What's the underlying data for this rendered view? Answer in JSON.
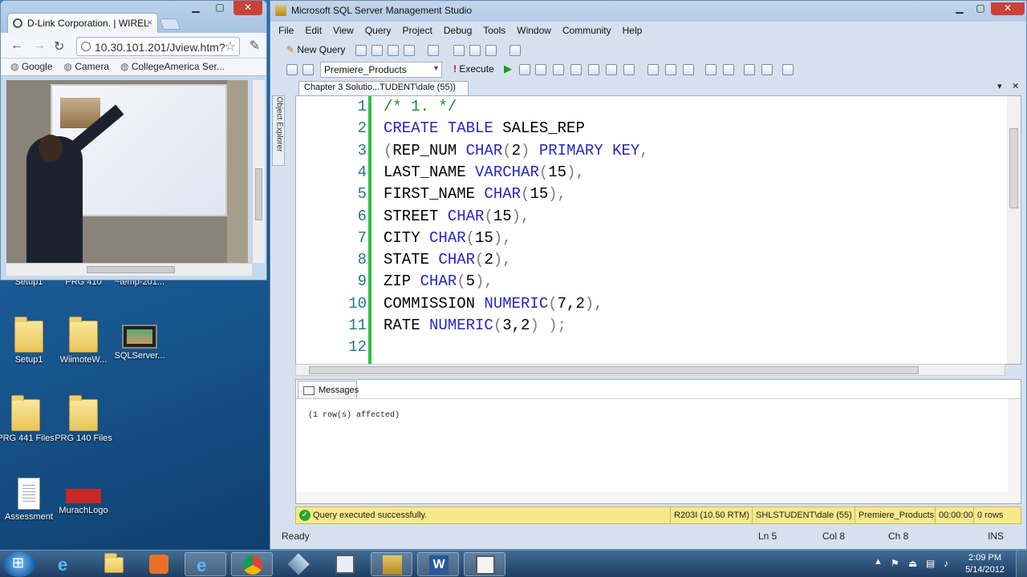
{
  "desktop": {
    "icons": [
      {
        "label": "Setup1"
      },
      {
        "label": "PRG 410"
      },
      {
        "label": "~temp-201..."
      },
      {
        "label": "Setup1"
      },
      {
        "label": "WiimoteW..."
      },
      {
        "label": "SQLServer..."
      },
      {
        "label": "PRG 441 Files"
      },
      {
        "label": "PRG 140 Files"
      },
      {
        "label": "Assessment"
      },
      {
        "label": "MurachLogo"
      }
    ]
  },
  "browser": {
    "tab_title": "D-Link Corporation. | WIREL",
    "tab_close": "×",
    "url": "10.30.101.201/Jview.htm?",
    "bookmarks": [
      "Google",
      "Camera",
      "CollegeAmerica Ser..."
    ]
  },
  "ssms": {
    "title": "Microsoft SQL Server Management Studio",
    "menu": [
      "File",
      "Edit",
      "View",
      "Query",
      "Project",
      "Debug",
      "Tools",
      "Window",
      "Community",
      "Help"
    ],
    "new_query": "New Query",
    "database": "Premiere_Products",
    "execute": "Execute",
    "object_explorer": "Object Explorer",
    "doc_tab": "Chapter 3 Solutio...TUDENT\\dale (55))",
    "code": [
      {
        "n": "1",
        "parts": [
          {
            "t": "/* 1. */",
            "c": "cm"
          }
        ]
      },
      {
        "n": "2",
        "parts": [
          {
            "t": "CREATE TABLE",
            "c": "kw"
          },
          {
            "t": " SALES_REP",
            "c": ""
          }
        ]
      },
      {
        "n": "3",
        "parts": [
          {
            "t": "(",
            "c": "gr"
          },
          {
            "t": "REP_NUM ",
            "c": ""
          },
          {
            "t": "CHAR",
            "c": "kw"
          },
          {
            "t": "(",
            "c": "gr"
          },
          {
            "t": "2",
            "c": ""
          },
          {
            "t": ") ",
            "c": "gr"
          },
          {
            "t": "PRIMARY KEY",
            "c": "kw"
          },
          {
            "t": ",",
            "c": "gr"
          }
        ]
      },
      {
        "n": "4",
        "parts": [
          {
            "t": "LAST_NAME ",
            "c": ""
          },
          {
            "t": "VARCHAR",
            "c": "kw"
          },
          {
            "t": "(",
            "c": "gr"
          },
          {
            "t": "15",
            "c": ""
          },
          {
            "t": "),",
            "c": "gr"
          }
        ]
      },
      {
        "n": "5",
        "parts": [
          {
            "t": "FIRST_NAME ",
            "c": ""
          },
          {
            "t": "CHAR",
            "c": "kw"
          },
          {
            "t": "(",
            "c": "gr"
          },
          {
            "t": "15",
            "c": ""
          },
          {
            "t": "),",
            "c": "gr"
          }
        ]
      },
      {
        "n": "6",
        "parts": [
          {
            "t": "STREET ",
            "c": ""
          },
          {
            "t": "CHAR",
            "c": "kw"
          },
          {
            "t": "(",
            "c": "gr"
          },
          {
            "t": "15",
            "c": ""
          },
          {
            "t": "),",
            "c": "gr"
          }
        ]
      },
      {
        "n": "7",
        "parts": [
          {
            "t": "CITY ",
            "c": ""
          },
          {
            "t": "CHAR",
            "c": "kw"
          },
          {
            "t": "(",
            "c": "gr"
          },
          {
            "t": "15",
            "c": ""
          },
          {
            "t": "),",
            "c": "gr"
          }
        ]
      },
      {
        "n": "8",
        "parts": [
          {
            "t": "STATE ",
            "c": ""
          },
          {
            "t": "CHAR",
            "c": "kw"
          },
          {
            "t": "(",
            "c": "gr"
          },
          {
            "t": "2",
            "c": ""
          },
          {
            "t": "),",
            "c": "gr"
          }
        ]
      },
      {
        "n": "9",
        "parts": [
          {
            "t": "ZIP ",
            "c": ""
          },
          {
            "t": "CHAR",
            "c": "kw"
          },
          {
            "t": "(",
            "c": "gr"
          },
          {
            "t": "5",
            "c": ""
          },
          {
            "t": "),",
            "c": "gr"
          }
        ]
      },
      {
        "n": "10",
        "parts": [
          {
            "t": "COMMISSION ",
            "c": ""
          },
          {
            "t": "NUMERIC",
            "c": "kw"
          },
          {
            "t": "(",
            "c": "gr"
          },
          {
            "t": "7,2",
            "c": ""
          },
          {
            "t": "),",
            "c": "gr"
          }
        ]
      },
      {
        "n": "11",
        "parts": [
          {
            "t": "RATE ",
            "c": ""
          },
          {
            "t": "NUMERIC",
            "c": "kw"
          },
          {
            "t": "(",
            "c": "gr"
          },
          {
            "t": "3,2",
            "c": ""
          },
          {
            "t": ") );",
            "c": "gr"
          }
        ]
      },
      {
        "n": "12",
        "parts": []
      }
    ],
    "messages_tab": "Messages",
    "message": "(1 row(s) affected)",
    "query_status": "Query executed successfully.",
    "status_segments": [
      "R203I (10.50 RTM)",
      "SHLSTUDENT\\dale (55)",
      "Premiere_Products",
      "00:00:00",
      "0 rows"
    ],
    "status": {
      "ready": "Ready",
      "ln": "Ln 5",
      "col": "Col 8",
      "ch": "Ch 8",
      "ins": "INS"
    }
  },
  "taskbar": {
    "time": "2:09 PM",
    "date": "5/14/2012"
  },
  "colors": {
    "keyword": "#2626c6",
    "comment": "#1e8a1e",
    "line_number": "#1f7a87",
    "status_yellow": "#f7e98a"
  }
}
